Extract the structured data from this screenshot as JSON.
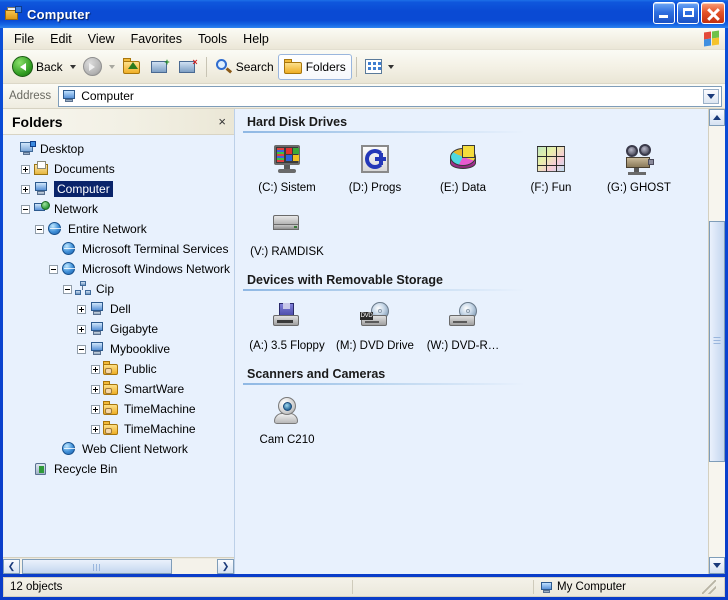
{
  "window": {
    "title": "Computer",
    "icon": "folder-document-icon",
    "controls": {
      "minimize": "Minimize",
      "maximize": "Maximize",
      "close": "Close"
    }
  },
  "menubar": {
    "items": [
      {
        "label": "File"
      },
      {
        "label": "Edit"
      },
      {
        "label": "View"
      },
      {
        "label": "Favorites"
      },
      {
        "label": "Tools"
      },
      {
        "label": "Help"
      }
    ],
    "logo_icon": "windows-flag-icon"
  },
  "toolbar": {
    "back_label": "Back",
    "search_label": "Search",
    "folders_label": "Folders",
    "icons": {
      "back": "back-arrow-icon",
      "back_dropdown": "chevron-down-icon",
      "forward": "forward-arrow-icon",
      "forward_dropdown": "chevron-down-icon",
      "up": "up-one-level-icon",
      "map_drive": "map-network-drive-icon",
      "disconnect_drive": "disconnect-network-drive-icon",
      "search": "search-magnifier-icon",
      "folders": "folder-icon",
      "views": "views-icon",
      "views_dropdown": "chevron-down-icon"
    }
  },
  "address": {
    "label": "Address",
    "value": "Computer",
    "icon": "my-computer-icon",
    "dropdown_icon": "chevron-down-icon"
  },
  "folders_pane": {
    "title": "Folders",
    "close_label": "×",
    "tree": [
      {
        "label": "Desktop",
        "indent": 0,
        "expander": "none",
        "icon": "desktop-icon",
        "selected": false
      },
      {
        "label": "Documents",
        "indent": 1,
        "expander": "plus",
        "icon": "documents-icon",
        "selected": false
      },
      {
        "label": "Computer",
        "indent": 1,
        "expander": "plus",
        "icon": "my-computer-icon",
        "selected": true
      },
      {
        "label": "Network",
        "indent": 1,
        "expander": "minus",
        "icon": "network-icon",
        "selected": false
      },
      {
        "label": "Entire Network",
        "indent": 2,
        "expander": "minus",
        "icon": "globe-icon",
        "selected": false
      },
      {
        "label": "Microsoft Terminal Services",
        "indent": 3,
        "expander": "none",
        "icon": "globe-icon",
        "selected": false
      },
      {
        "label": "Microsoft Windows Network",
        "indent": 3,
        "expander": "minus",
        "icon": "globe-icon",
        "selected": false
      },
      {
        "label": "Cip",
        "indent": 4,
        "expander": "minus",
        "icon": "workgroup-icon",
        "selected": false
      },
      {
        "label": "Dell",
        "indent": 5,
        "expander": "plus",
        "icon": "my-computer-icon",
        "selected": false
      },
      {
        "label": "Gigabyte",
        "indent": 5,
        "expander": "plus",
        "icon": "my-computer-icon",
        "selected": false
      },
      {
        "label": "Mybooklive",
        "indent": 5,
        "expander": "minus",
        "icon": "my-computer-icon",
        "selected": false
      },
      {
        "label": "Public",
        "indent": 6,
        "expander": "plus",
        "icon": "shared-folder-icon",
        "selected": false
      },
      {
        "label": "SmartWare",
        "indent": 6,
        "expander": "plus",
        "icon": "shared-folder-icon",
        "selected": false
      },
      {
        "label": "TimeMachine",
        "indent": 6,
        "expander": "plus",
        "icon": "shared-folder-icon",
        "selected": false
      },
      {
        "label": "TimeMachine",
        "indent": 6,
        "expander": "plus",
        "icon": "shared-folder-icon",
        "selected": false
      },
      {
        "label": "Web Client Network",
        "indent": 3,
        "expander": "none",
        "icon": "globe-icon",
        "selected": false
      },
      {
        "label": "Recycle Bin",
        "indent": 1,
        "expander": "none",
        "icon": "recycle-bin-icon",
        "selected": false
      }
    ],
    "hscrollbar": {
      "left_arrow": "❮",
      "right_arrow": "❯"
    }
  },
  "content": {
    "groups": [
      {
        "header": "Hard Disk Drives",
        "items": [
          {
            "label": "(C:) Sistem",
            "icon": "drive-monitor-icon"
          },
          {
            "label": "(D:) Progs",
            "icon": "drive-cplus-icon"
          },
          {
            "label": "(E:) Data",
            "icon": "drive-piechart-icon"
          },
          {
            "label": "(F:) Fun",
            "icon": "drive-map-icon"
          },
          {
            "label": "(G:) GHOST",
            "icon": "drive-film-icon"
          },
          {
            "label": "(V:) RAMDISK",
            "icon": "drive-hdd-icon"
          }
        ]
      },
      {
        "header": "Devices with Removable Storage",
        "items": [
          {
            "label": "(A:) 3.5 Floppy",
            "icon": "floppy-drive-icon"
          },
          {
            "label": "(M:) DVD Drive",
            "icon": "dvd-drive-icon",
            "badge": "DVD"
          },
          {
            "label": "(W:) DVD-R…",
            "icon": "dvd-rw-drive-icon"
          }
        ]
      },
      {
        "header": "Scanners and Cameras",
        "items": [
          {
            "label": "Cam C210",
            "icon": "webcam-icon"
          }
        ]
      }
    ]
  },
  "statusbar": {
    "object_count": "12 objects",
    "location": "My Computer",
    "location_icon": "my-computer-icon"
  }
}
